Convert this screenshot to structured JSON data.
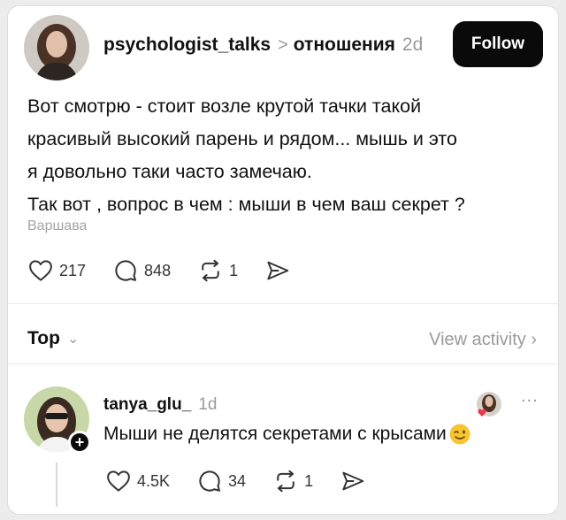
{
  "post": {
    "username": "psychologist_talks",
    "chevron": ">",
    "topic": "отношения",
    "time": "2d",
    "follow_label": "Follow",
    "text_lines": [
      "Вот смотрю - стоит возле крутой тачки такой",
      "красивый высокий парень и рядом... мышь и это",
      "я довольно таки часто замечаю.",
      "Так вот , вопрос в чем : мыши в чем ваш секрет ?"
    ],
    "location": "Варшава",
    "likes": "217",
    "comments": "848",
    "reposts": "1"
  },
  "sort": {
    "label": "Top",
    "view_activity": "View activity"
  },
  "reply": {
    "username": "tanya_glu_",
    "time": "1d",
    "text": "Мыши не делятся секретами с крысами",
    "likes": "4.5K",
    "comments": "34",
    "reposts": "1",
    "more": "..."
  }
}
